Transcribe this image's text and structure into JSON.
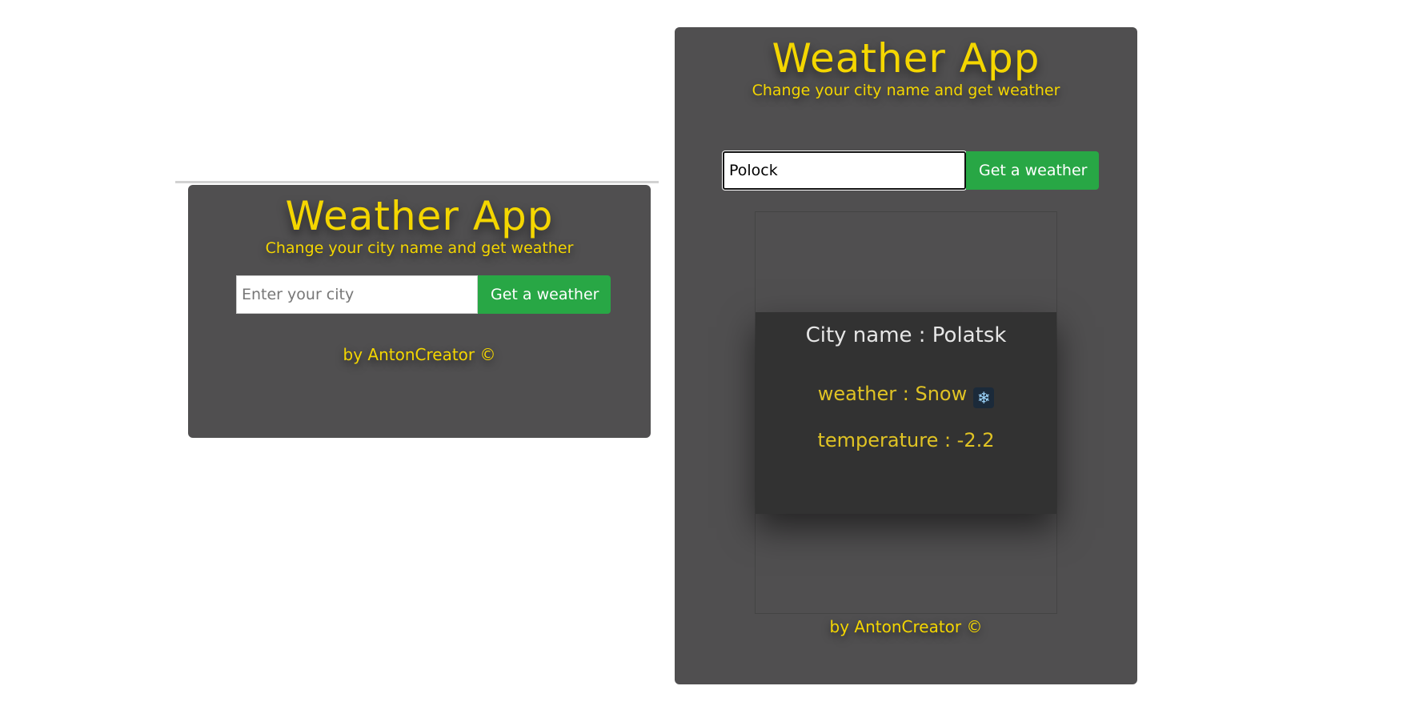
{
  "left_card": {
    "title": "Weather App",
    "subtitle": "Change your city name and get weather",
    "input_placeholder": "Enter your city",
    "input_value": "",
    "button_label": "Get a weather",
    "footer": "by AntonCreator ©"
  },
  "right_card": {
    "title": "Weather App",
    "subtitle": "Change your city name and get weather",
    "input_value": "Polock",
    "button_label": "Get a weather",
    "result": {
      "city": "City name : Polatsk",
      "weather": "weather : Snow",
      "weather_icon": "snowflake-icon",
      "temperature": "temperature : -2.2"
    },
    "footer": "by AntonCreator ©"
  },
  "colors": {
    "card_bg": "#504f50",
    "accent_yellow": "#f4d600",
    "button_green": "#28a745",
    "result_bg": "#323232"
  }
}
